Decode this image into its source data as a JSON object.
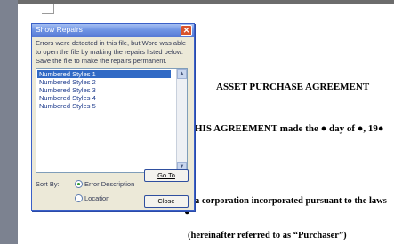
{
  "document": {
    "title": "ASSET PURCHASE AGREEMENT",
    "line_1": "HIS AGREEMENT made the ● day of ●, 19●",
    "line_2": "a corporation incorporated pursuant to the laws",
    "bullet_fragment": "●",
    "line_3": "(hereinafter referred to as “Purchaser”)"
  },
  "dialog": {
    "title": "Show Repairs",
    "close_glyph": "✕",
    "message_lines": [
      "Errors were detected in this file, but Word was able",
      "to open the file by making the repairs listed below.",
      "Save the file to make the repairs permanent."
    ],
    "repairs": [
      {
        "label": "Numbered Styles 1",
        "selected": true
      },
      {
        "label": "Numbered Styles 2",
        "selected": false
      },
      {
        "label": "Numbered Styles 3",
        "selected": false
      },
      {
        "label": "Numbered Styles 4",
        "selected": false
      },
      {
        "label": "Numbered Styles 5",
        "selected": false
      }
    ],
    "sort_by_label": "Sort By:",
    "sort_options": [
      {
        "label": "Error Description",
        "checked": true
      },
      {
        "label": "Location",
        "checked": false
      }
    ],
    "goto_label": "Go To",
    "close_label": "Close"
  },
  "colors": {
    "titlebar": "#6f94e4",
    "selection": "#316ac5",
    "dialog_face": "#ece9d8"
  }
}
